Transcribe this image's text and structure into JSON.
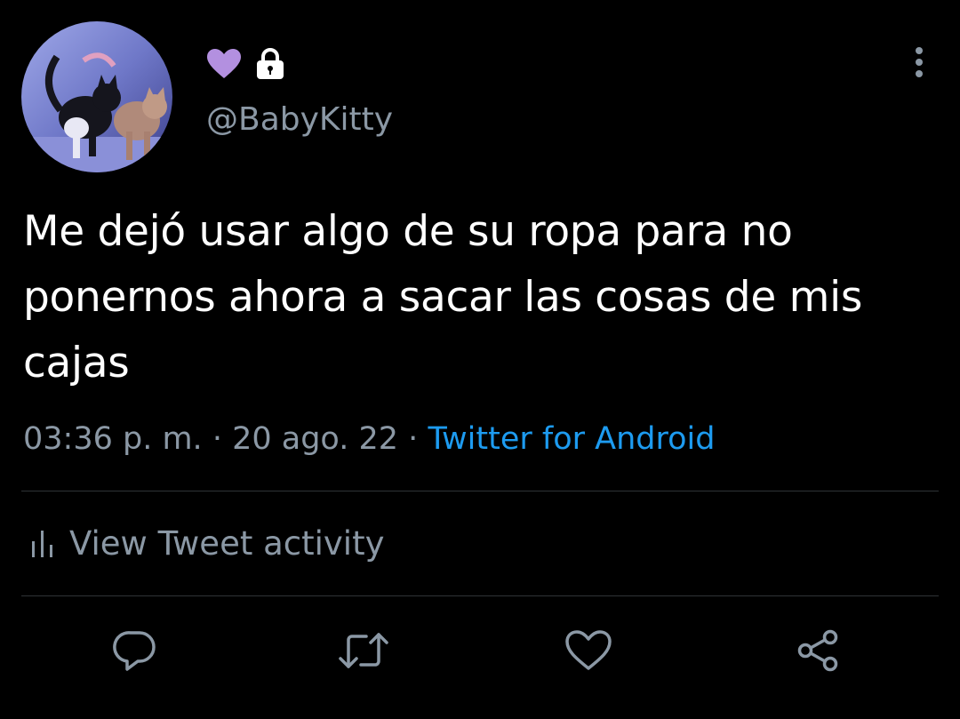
{
  "profile": {
    "avatar_alt": "",
    "name_icons": [
      "purple-heart-icon",
      "lock-icon"
    ],
    "handle": "@BabyKitty"
  },
  "tweet": {
    "text": "Me dejó usar algo de su ropa para no ponernos ahora a sacar las cosas de mis cajas",
    "time": "03:36 p. m.",
    "separator": "·",
    "date": "20 ago. 22",
    "source": "Twitter for Android"
  },
  "activity": {
    "label": "View Tweet activity",
    "icon": "bar-chart-icon"
  },
  "actions": [
    {
      "name": "reply",
      "icon": "reply-icon"
    },
    {
      "name": "retweet",
      "icon": "retweet-icon"
    },
    {
      "name": "like",
      "icon": "heart-icon"
    },
    {
      "name": "share",
      "icon": "share-icon"
    }
  ],
  "colors": {
    "background": "#000000",
    "text_primary": "#ffffff",
    "text_secondary": "#8b98a5",
    "link": "#1d9bf0",
    "divider": "#2f3336",
    "heart_emoji": "#b390e0"
  }
}
